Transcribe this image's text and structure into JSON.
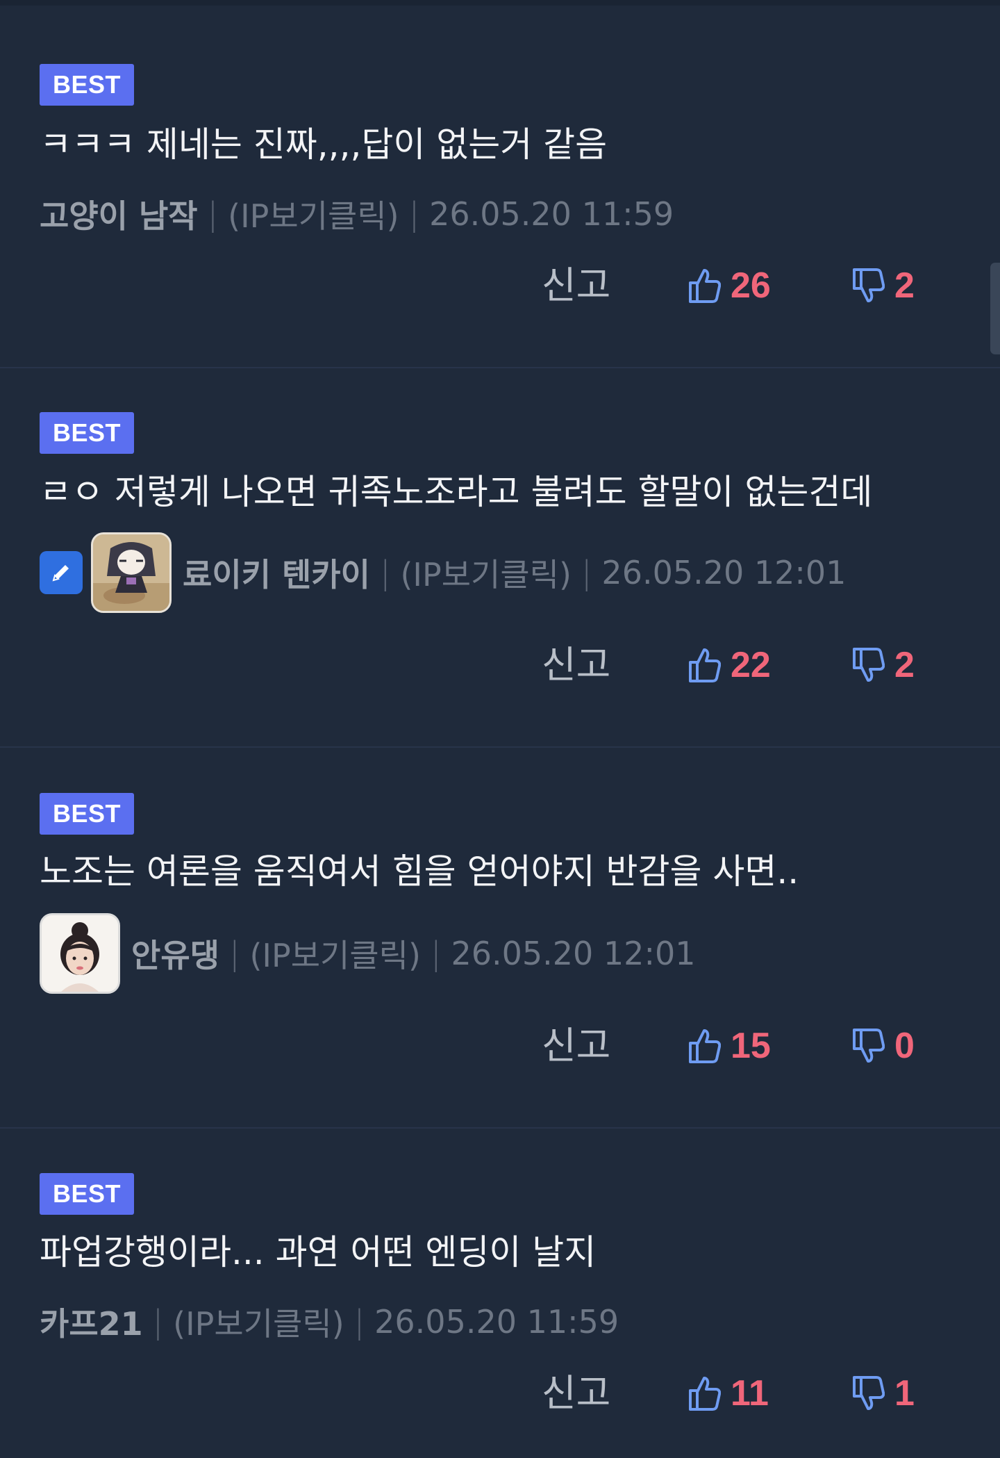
{
  "comments": [
    {
      "badge": "BEST",
      "text": "ㅋㅋㅋ 제네는 진짜,,,,답이 없는거 같음",
      "author": "고양이 남작",
      "ip": "(IP보기클릭)",
      "date": "26.05.20 11:59",
      "report": "신고",
      "likes": "26",
      "dislikes": "2"
    },
    {
      "badge": "BEST",
      "text": "ㄹㅇ 저렇게 나오면 귀족노조라고 불려도 할말이 없는건데",
      "author": "료이키 텐카이",
      "ip": "(IP보기클릭)",
      "date": "26.05.20 12:01",
      "report": "신고",
      "likes": "22",
      "dislikes": "2"
    },
    {
      "badge": "BEST",
      "text": "노조는 여론을 움직여서 힘을 얻어야지 반감을 사면..",
      "author": "안유댕",
      "ip": "(IP보기클릭)",
      "date": "26.05.20 12:01",
      "report": "신고",
      "likes": "15",
      "dislikes": "0"
    },
    {
      "badge": "BEST",
      "text": "파업강행이라... 과연 어떤 엔딩이 날지",
      "author": "카프21",
      "ip": "(IP보기클릭)",
      "date": "26.05.20 11:59",
      "report": "신고",
      "likes": "11",
      "dislikes": "1"
    }
  ],
  "icons": {
    "like": "thumbs-up-icon",
    "dislike": "thumbs-down-icon",
    "edit": "pencil-icon"
  },
  "colors": {
    "background": "#1f2a3b",
    "badge": "#5b6ff0",
    "count": "#f0667a",
    "thumb": "#6f9cf2"
  }
}
